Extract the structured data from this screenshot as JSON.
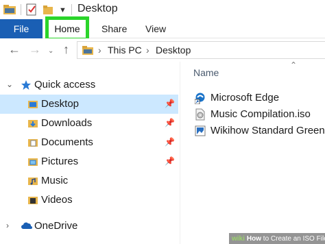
{
  "window": {
    "title": "Desktop"
  },
  "ribbon": {
    "tabs": [
      {
        "label": "File"
      },
      {
        "label": "Home"
      },
      {
        "label": "Share"
      },
      {
        "label": "View"
      }
    ]
  },
  "address": {
    "segments": [
      "This PC",
      "Desktop"
    ]
  },
  "navpane": {
    "quick_access": "Quick access",
    "items": [
      {
        "label": "Desktop",
        "pinned": true,
        "selected": true
      },
      {
        "label": "Downloads",
        "pinned": true
      },
      {
        "label": "Documents",
        "pinned": true
      },
      {
        "label": "Pictures",
        "pinned": true
      },
      {
        "label": "Music"
      },
      {
        "label": "Videos"
      }
    ],
    "onedrive": "OneDrive"
  },
  "content": {
    "column_header": "Name",
    "files": [
      {
        "name": "Microsoft Edge",
        "icon": "edge-shortcut-icon"
      },
      {
        "name": "Music Compilation.iso",
        "icon": "iso-file-icon"
      },
      {
        "name": "Wikihow Standard Green W",
        "icon": "image-file-icon"
      }
    ]
  },
  "watermark": {
    "prefix": "wiki",
    "brand": "How",
    "text": " to Create an ISO File"
  },
  "colors": {
    "accent": "#1a5fb4",
    "highlight": "#2ad52a",
    "selected": "#cce8ff",
    "folder": "#e8b64c"
  }
}
